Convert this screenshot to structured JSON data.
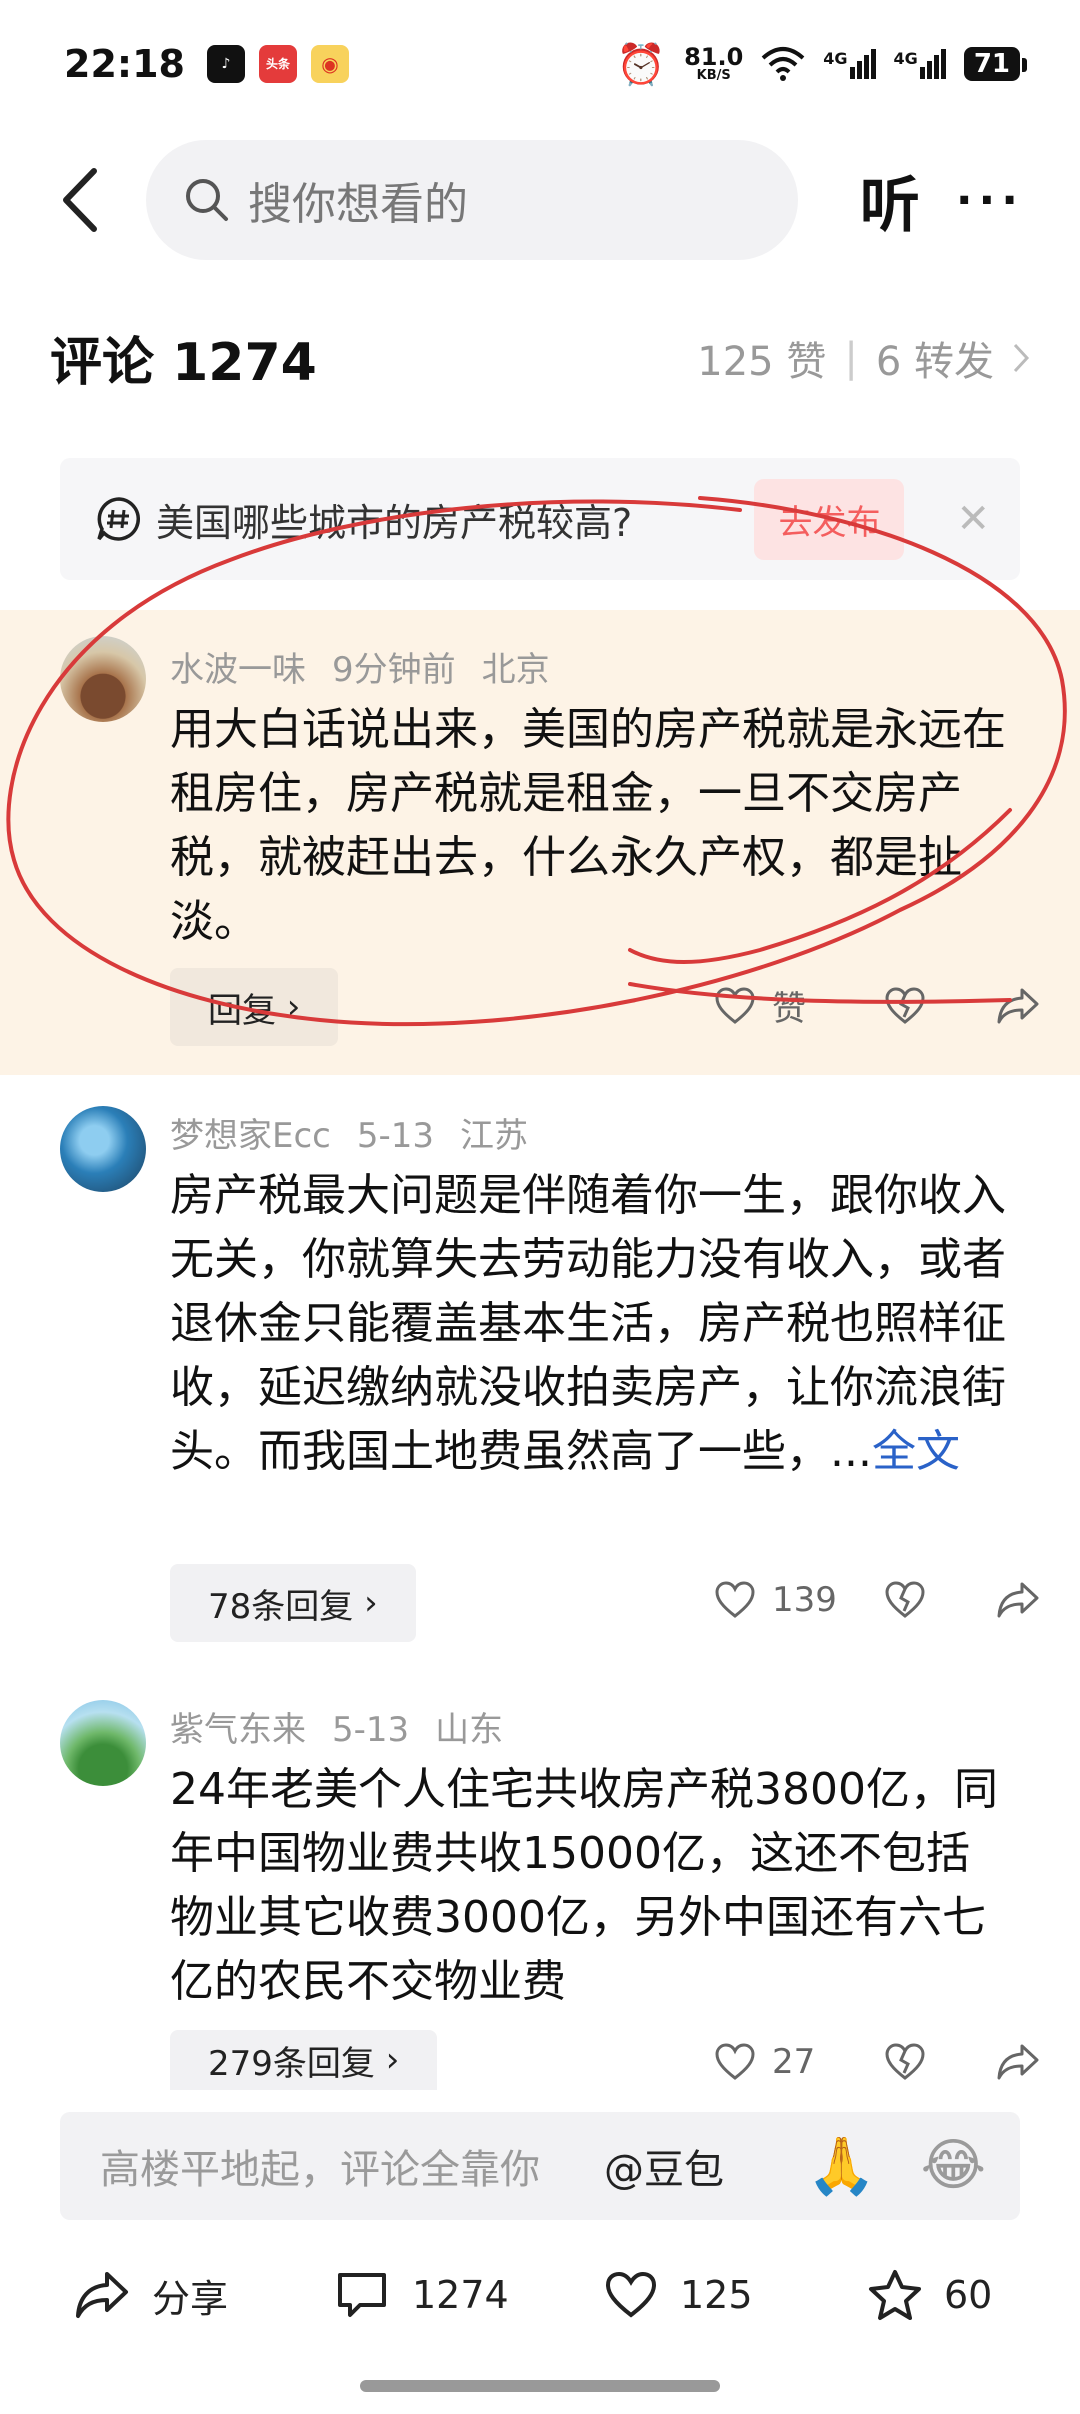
{
  "status": {
    "time": "22:18",
    "speed_value": "81.0",
    "speed_unit": "KB/S",
    "net1": "4G",
    "net2": "4G",
    "battery": "71"
  },
  "search": {
    "placeholder": "搜你想看的"
  },
  "header": {
    "listen": "听",
    "more": "···"
  },
  "comments_header": {
    "title": "评论 1274",
    "likes": "125 赞",
    "separator": "|",
    "shares": "6 转发"
  },
  "prompt": {
    "text": "美国哪些城市的房产税较高?",
    "button": "去发布"
  },
  "comments": [
    {
      "user": "水波一味",
      "time": "9分钟前",
      "location": "北京",
      "text": "用大白话说出来，美国的房产税就是永远在租房住，房产税就是租金，一旦不交房产税，就被赶出去，什么永久产权，都是扯淡。",
      "reply": "回复",
      "likes": "赞"
    },
    {
      "user": "梦想家Ecc",
      "time": "5-13",
      "location": "江苏",
      "text": "房产税最大问题是伴随着你一生，跟你收入无关，你就算失去劳动能力没有收入，或者退休金只能覆盖基本生活，房产税也照样征收，延迟缴纳就没收拍卖房产，让你流浪街头。而我国土地费虽然高了一些，...",
      "more": "全文",
      "reply": "78条回复",
      "likes": "139"
    },
    {
      "user": "紫气东来",
      "time": "5-13",
      "location": "山东",
      "text": "24年老美个人住宅共收房产税3800亿，同年中国物业费共收15000亿，这还不包括物业其它收费3000亿，另外中国还有六七亿的农民不交物业费",
      "reply": "279条回复",
      "likes": "27"
    }
  ],
  "input": {
    "placeholder": "高楼平地起，评论全靠你",
    "mention": "@豆包",
    "emoji1": "🙏",
    "emoji2": "😂"
  },
  "bottom_bar": {
    "share": "分享",
    "comments": "1274",
    "likes": "125",
    "favorites": "60"
  },
  "colors": {
    "highlight_bg": "#fdf3e6",
    "link": "#2a62c8",
    "accent": "#f45e5e",
    "annotation": "#d83a3a"
  }
}
